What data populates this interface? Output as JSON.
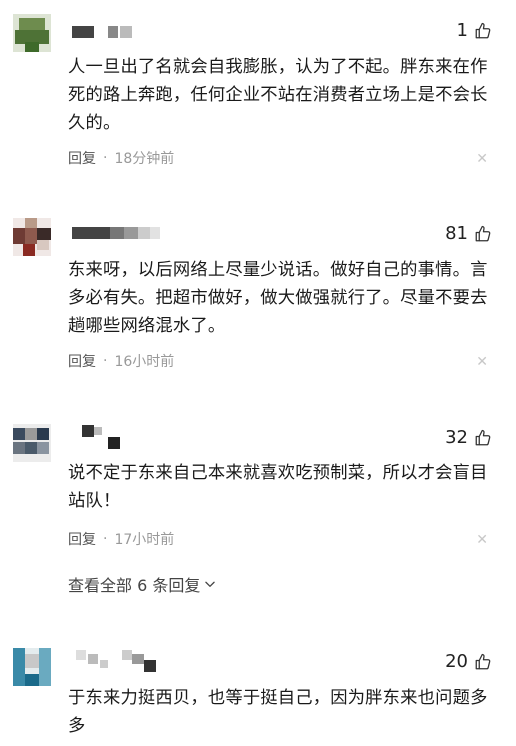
{
  "comments": [
    {
      "likes": "1",
      "text": "人一旦出了名就会自我膨胀，认为了不起。胖东来在作死的路上奔跑，任何企业不站在消费者立场上是不会长久的。",
      "reply_label": "回复",
      "separator": "·",
      "time": "18分钟前",
      "close_icon": "close-icon",
      "avatar_colors": [
        "#5a7a3a",
        "#7e9a5e",
        "#3e6a2a",
        "#c8d2b8"
      ]
    },
    {
      "likes": "81",
      "text": "东来呀，以后网络上尽量少说话。做好自己的事情。言多必有失。把超市做好，做大做强就行了。尽量不要去趟哪些网络混水了。",
      "reply_label": "回复",
      "separator": "·",
      "time": "16小时前",
      "close_icon": "close-icon",
      "avatar_colors": [
        "#6e3b34",
        "#b99a88",
        "#8a2a22",
        "#3a2a28"
      ]
    },
    {
      "likes": "32",
      "text": "说不定于东来自己本来就喜欢吃预制菜，所以才会盲目站队！",
      "reply_label": "回复",
      "separator": "·",
      "time": "17小时前",
      "close_icon": "close-icon",
      "avatar_colors": [
        "#2a3a4e",
        "#8a8a8a",
        "#4a5a6a",
        "#d8d8d8"
      ]
    },
    {
      "likes": "20",
      "text": "于东来力挺西贝，也等于挺自己，因为胖东来也问题多多",
      "avatar_colors": [
        "#3a8aa8",
        "#9ec8d8",
        "#1a6a8a",
        "#c8c8c8"
      ]
    }
  ],
  "view_all": {
    "label": "查看全部 6 条回复",
    "icon": "chevron-down-icon"
  },
  "like_icon": "thumbs-up-icon"
}
